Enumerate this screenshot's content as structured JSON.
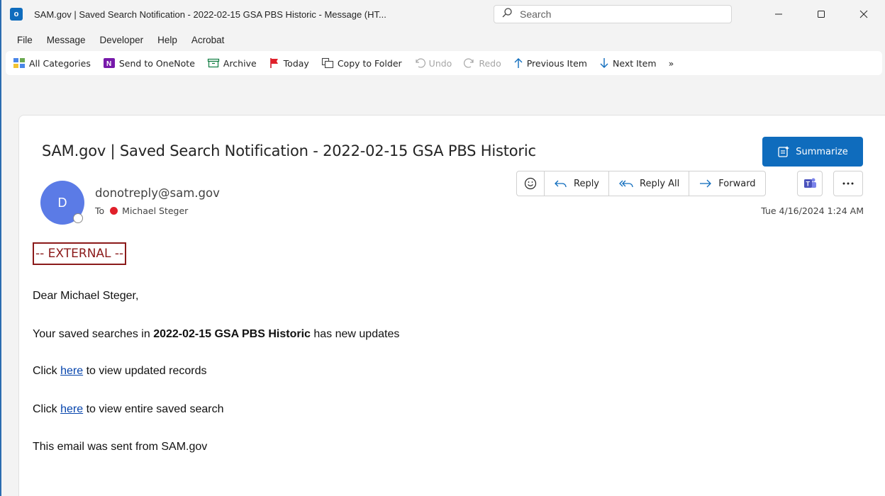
{
  "window": {
    "app_icon_letter": "o",
    "title": "SAM.gov | Saved Search Notification - 2022-02-15 GSA PBS Historic  -  Message (HT...",
    "search_placeholder": "Search"
  },
  "menu": [
    "File",
    "Message",
    "Developer",
    "Help",
    "Acrobat"
  ],
  "toolbar": {
    "all_categories": "All Categories",
    "send_to_onenote": "Send to OneNote",
    "archive": "Archive",
    "today": "Today",
    "copy_to_folder": "Copy to Folder",
    "undo": "Undo",
    "redo": "Redo",
    "previous_item": "Previous Item",
    "next_item": "Next Item",
    "overflow": "»"
  },
  "message": {
    "subject": "SAM.gov | Saved Search Notification - 2022-02-15 GSA PBS Historic",
    "summarize_label": "Summarize",
    "avatar_letter": "D",
    "sender": "donotreply@sam.gov",
    "to_label": "To",
    "recipient": "Michael Steger",
    "reply": "Reply",
    "reply_all": "Reply All",
    "forward": "Forward",
    "date": "Tue 4/16/2024 1:24 AM"
  },
  "body": {
    "external_tag": "-- EXTERNAL --",
    "greeting": "Dear Michael Steger,",
    "line1_pre": "Your saved searches in ",
    "line1_bold": "2022-02-15 GSA PBS Historic",
    "line1_post": " has new updates",
    "click": "Click ",
    "here": "here",
    "line2_post": " to view updated records",
    "line3_post": " to view entire saved search",
    "footer": "This email was sent from SAM.gov"
  },
  "colors": {
    "accent": "#0f6cbd",
    "avatar": "#5b7be6",
    "external": "#8b1a1a",
    "presence_busy": "#e0202a",
    "link": "#0645ad"
  }
}
